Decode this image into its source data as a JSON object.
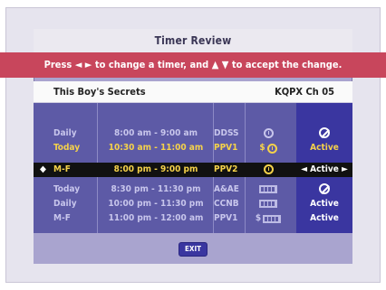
{
  "title": "Timer Review",
  "banner": {
    "text_before": "Press",
    "arrows_lr": "◄ ►",
    "text_mid": "to change a timer, and",
    "arrows_ud": "▲ ▼",
    "text_after": "to accept the change."
  },
  "program": {
    "name": "This Boy's Secrets",
    "channel": "KQPX  Ch 05"
  },
  "timers": [
    {
      "day": "Daily",
      "time": "8:00 am - 9:00 am",
      "network": "DDSS",
      "icon": "clock-icon",
      "status": "",
      "status_icon": "ban-icon",
      "color": "lavender"
    },
    {
      "day": "Today",
      "time": "10:30 am - 11:00 am",
      "network": "PPV1",
      "icon": "dollar-clock-icon",
      "status": "Active",
      "status_icon": "",
      "color": "yellow"
    },
    {
      "day": "M-F",
      "time": "8:00 pm - 9:00 pm",
      "network": "PPV2",
      "icon": "clock-icon",
      "status": "Active",
      "status_icon": "",
      "color": "selected"
    },
    {
      "day": "Today",
      "time": "8:30 pm - 11:30 pm",
      "network": "A&AE",
      "icon": "film-icon",
      "status": "",
      "status_icon": "ban-icon",
      "color": "lavender"
    },
    {
      "day": "Daily",
      "time": "10:00 pm - 11:30 pm",
      "network": "CCNB",
      "icon": "film-icon",
      "status": "Active",
      "status_icon": "",
      "color": "lavender"
    },
    {
      "day": "M-F",
      "time": "11:00 pm - 12:00 am",
      "network": "PPV1",
      "icon": "dollar-film-icon",
      "status": "Active",
      "status_icon": "",
      "color": "lavender"
    }
  ],
  "exit_label": "EXIT",
  "colors": {
    "banner": "#c8465c",
    "dialog": "#a9a4cf",
    "table": "#5d5aa6",
    "status_column": "#3a36a0",
    "highlight_text": "#f5d24a"
  }
}
